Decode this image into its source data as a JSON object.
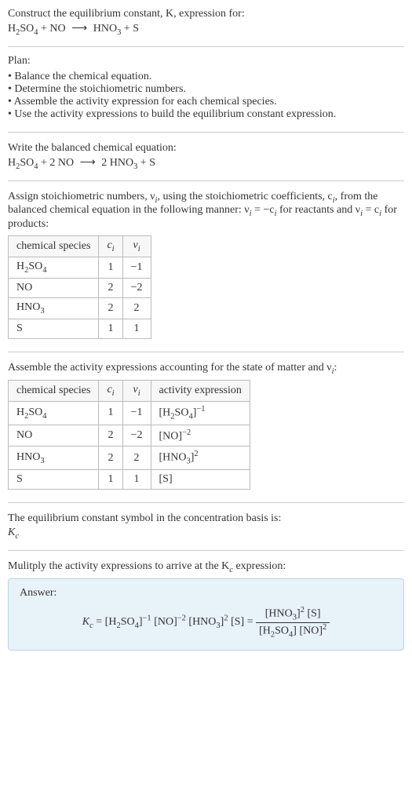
{
  "question": {
    "prompt": "Construct the equilibrium constant, K, expression for:",
    "equation_lhs1": "H",
    "equation_lhs1_sub1": "2",
    "equation_lhs1_mid": "SO",
    "equation_lhs1_sub2": "4",
    "plus1": " + NO ",
    "arrow": "⟶",
    "rhs1": " HNO",
    "rhs1_sub": "3",
    "rhs2": " + S"
  },
  "plan": {
    "label": "Plan:",
    "items": [
      "Balance the chemical equation.",
      "Determine the stoichiometric numbers.",
      "Assemble the activity expression for each chemical species.",
      "Use the activity expressions to build the equilibrium constant expression."
    ]
  },
  "balanced": {
    "intro": "Write the balanced chemical equation:",
    "lhs1a": "H",
    "lhs1a_sub": "2",
    "lhs1b": "SO",
    "lhs1b_sub": "4",
    "plus": " + 2 NO ",
    "arrow": "⟶",
    "rhs": " 2 HNO",
    "rhs_sub": "3",
    "rhs2": " + S"
  },
  "stoich": {
    "intro1": "Assign stoichiometric numbers, ν",
    "intro1_sub": "i",
    "intro2": ", using the stoichiometric coefficients, c",
    "intro2_sub": "i",
    "intro3": ", from the balanced chemical equation in the following manner: ν",
    "intro3_sub": "i",
    "intro4": " = −c",
    "intro4_sub": "i",
    "intro5": " for reactants and ν",
    "intro5_sub": "i",
    "intro6": " = c",
    "intro6_sub": "i",
    "intro7": " for products:",
    "headers": {
      "species": "chemical species",
      "c": "c",
      "c_sub": "i",
      "v": "ν",
      "v_sub": "i"
    },
    "rows": [
      {
        "species_a": "H",
        "species_a_sub": "2",
        "species_b": "SO",
        "species_b_sub": "4",
        "c": "1",
        "v": "−1"
      },
      {
        "species_a": "NO",
        "species_a_sub": "",
        "species_b": "",
        "species_b_sub": "",
        "c": "2",
        "v": "−2"
      },
      {
        "species_a": "HNO",
        "species_a_sub": "3",
        "species_b": "",
        "species_b_sub": "",
        "c": "2",
        "v": "2"
      },
      {
        "species_a": "S",
        "species_a_sub": "",
        "species_b": "",
        "species_b_sub": "",
        "c": "1",
        "v": "1"
      }
    ]
  },
  "activity": {
    "intro1": "Assemble the activity expressions accounting for the state of matter and ν",
    "intro1_sub": "i",
    "intro2": ":",
    "headers": {
      "species": "chemical species",
      "c": "c",
      "c_sub": "i",
      "v": "ν",
      "v_sub": "i",
      "act": "activity expression"
    },
    "rows": [
      {
        "species_a": "H",
        "species_a_sub": "2",
        "species_b": "SO",
        "species_b_sub": "4",
        "c": "1",
        "v": "−1",
        "act_a": "[H",
        "act_a_sub": "2",
        "act_b": "SO",
        "act_b_sub": "4",
        "act_c": "]",
        "act_sup": "−1"
      },
      {
        "species_a": "NO",
        "species_a_sub": "",
        "species_b": "",
        "species_b_sub": "",
        "c": "2",
        "v": "−2",
        "act_a": "[NO]",
        "act_a_sub": "",
        "act_b": "",
        "act_b_sub": "",
        "act_c": "",
        "act_sup": "−2"
      },
      {
        "species_a": "HNO",
        "species_a_sub": "3",
        "species_b": "",
        "species_b_sub": "",
        "c": "2",
        "v": "2",
        "act_a": "[HNO",
        "act_a_sub": "3",
        "act_b": "]",
        "act_b_sub": "",
        "act_c": "",
        "act_sup": "2"
      },
      {
        "species_a": "S",
        "species_a_sub": "",
        "species_b": "",
        "species_b_sub": "",
        "c": "1",
        "v": "1",
        "act_a": "[S]",
        "act_a_sub": "",
        "act_b": "",
        "act_b_sub": "",
        "act_c": "",
        "act_sup": ""
      }
    ]
  },
  "kc_symbol": {
    "intro": "The equilibrium constant symbol in the concentration basis is:",
    "sym": "K",
    "sym_sub": "c"
  },
  "multiply": {
    "intro1": "Mulitply the activity expressions to arrive at the K",
    "intro1_sub": "c",
    "intro2": " expression:"
  },
  "answer": {
    "label": "Answer:",
    "kc": "K",
    "kc_sub": "c",
    "eq": " = [H",
    "eq_sub1": "2",
    "eq2": "SO",
    "eq_sub2": "4",
    "eq3": "]",
    "eq_sup1": "−1",
    "eq4": " [NO]",
    "eq_sup2": "−2",
    "eq5": " [HNO",
    "eq_sub3": "3",
    "eq6": "]",
    "eq_sup3": "2",
    "eq7": " [S] = ",
    "num1": "[HNO",
    "num1_sub": "3",
    "num2": "]",
    "num2_sup": "2",
    "num3": " [S]",
    "den1": "[H",
    "den1_sub": "2",
    "den2": "SO",
    "den2_sub": "4",
    "den3": "] [NO]",
    "den3_sup": "2"
  }
}
